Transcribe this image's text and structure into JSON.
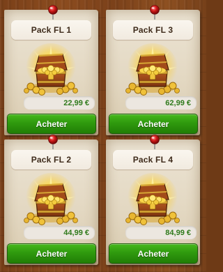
{
  "packs": [
    {
      "title": "Pack FL 1",
      "price": "22,99 €",
      "button_label": "Acheter",
      "image_icon": "treasure-chest-icon"
    },
    {
      "title": "Pack FL 3",
      "price": "62,99 €",
      "button_label": "Acheter",
      "image_icon": "treasure-chest-icon"
    },
    {
      "title": "Pack FL 2",
      "price": "44,99 €",
      "button_label": "Acheter",
      "image_icon": "treasure-chest-icon"
    },
    {
      "title": "Pack FL 4",
      "price": "84,99 €",
      "button_label": "Acheter",
      "image_icon": "treasure-chest-icon"
    }
  ],
  "colors": {
    "button_green": "#2f9a0e",
    "price_green": "#2f7a1c",
    "wood_brown": "#7a4019",
    "parchment": "#e3d8c2",
    "pin_red": "#d01818"
  }
}
